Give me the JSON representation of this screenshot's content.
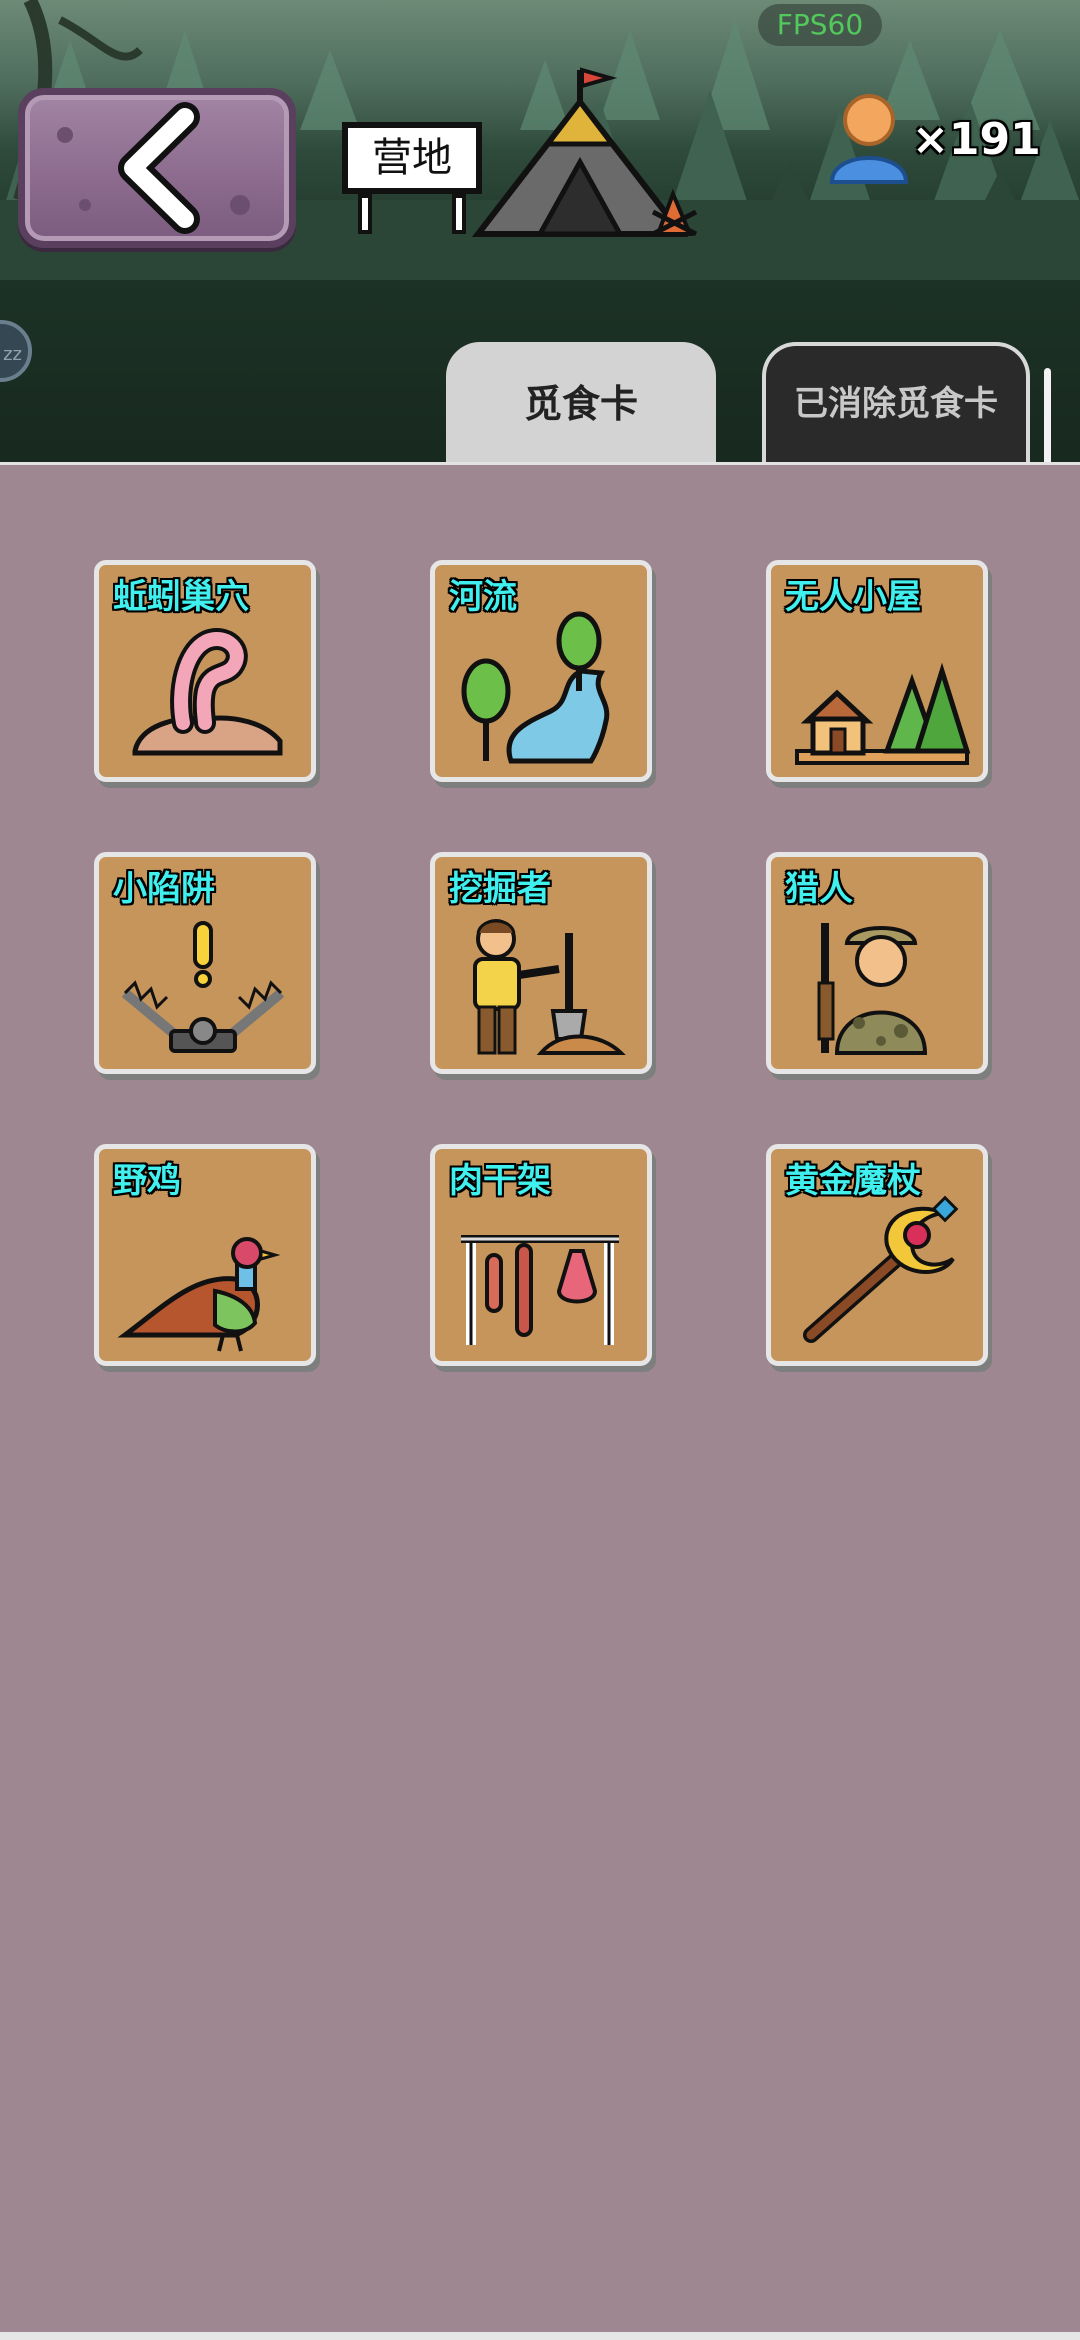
{
  "header": {
    "fps": "FPS60",
    "location_sign": "营地",
    "player_count": "×191"
  },
  "tabs": [
    {
      "label": "觅食卡",
      "active": true
    },
    {
      "label": "已消除觅食卡",
      "active": false
    }
  ],
  "cards": [
    {
      "title": "蚯蚓巢穴",
      "icon": "worm-burrow-icon"
    },
    {
      "title": "河流",
      "icon": "river-icon"
    },
    {
      "title": "无人小屋",
      "icon": "cabin-icon"
    },
    {
      "title": "小陷阱",
      "icon": "trap-icon"
    },
    {
      "title": "挖掘者",
      "icon": "digger-icon"
    },
    {
      "title": "猎人",
      "icon": "hunter-icon"
    },
    {
      "title": "野鸡",
      "icon": "pheasant-icon"
    },
    {
      "title": "肉干架",
      "icon": "meat-rack-icon"
    },
    {
      "title": "黄金魔杖",
      "icon": "golden-staff-icon"
    }
  ],
  "colors": {
    "background": "#9e8790",
    "card": "#c6955b",
    "card_title": "#3ff0ee",
    "active_tab": "#d3d3d3",
    "inactive_tab": "#2a2a2a"
  }
}
